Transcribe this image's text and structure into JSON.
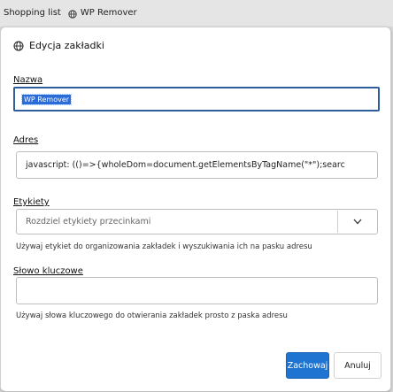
{
  "bookmarks_bar": {
    "items": [
      {
        "label": "Shopping list",
        "icon": "none"
      },
      {
        "label": "WP Remover",
        "icon": "globe-icon"
      }
    ]
  },
  "dialog": {
    "title": "Edycja zakładki",
    "title_icon": "globe-icon",
    "name": {
      "label": "Nazwa",
      "value": "WP Remover"
    },
    "address": {
      "label": "Adres",
      "value": "javascript: (()=>{wholeDom=document.getElementsByTagName(\"*\");searc"
    },
    "tags": {
      "label": "Etykiety",
      "placeholder": "Rozdziel etykiety przecinkami",
      "dropdown_icon": "chevron-down",
      "hint": "Używaj etykiet do organizowania zakładek i wyszukiwania ich na pasku adresu"
    },
    "keyword": {
      "label": "Słowo kluczowe",
      "value": "",
      "hint": "Używaj słowa kluczowego do otwierania zakładek prosto z paska adresu"
    },
    "buttons": {
      "save": "Zachowaj",
      "cancel": "Anuluj"
    }
  },
  "colors": {
    "accent": "#1f74d2",
    "focus_border": "#2f5e9c",
    "selection": "#2a6bd8"
  }
}
